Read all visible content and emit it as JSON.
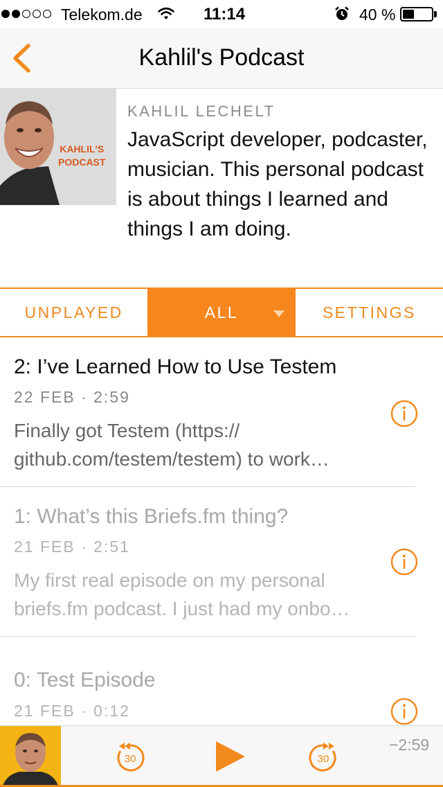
{
  "status_bar": {
    "signal_strength": 2,
    "signal_max": 5,
    "carrier": "Telekom.de",
    "time": "11:14",
    "battery_percent": "40 %",
    "battery_level": 0.4
  },
  "nav": {
    "title": "Kahlil's Podcast",
    "back_icon": "chevron-left-icon"
  },
  "podcast": {
    "cover_text_line1": "KAHLIL'S",
    "cover_text_line2": "PODCAST",
    "author": "KAHLIL LECHELT",
    "description": "JavaScript developer, podcaster, musician. This personal podcast is about things I learned and things I am doing."
  },
  "tabs": [
    {
      "label": "UNPLAYED",
      "active": false
    },
    {
      "label": "ALL",
      "active": true
    },
    {
      "label": "SETTINGS",
      "active": false
    }
  ],
  "episodes": [
    {
      "title": "2: I’ve Learned How to Use Testem",
      "meta": "22 FEB · 2:59",
      "desc_line1": "Finally got Testem (https://",
      "desc_line2": "github.com/testem/testem) to work…",
      "played": false
    },
    {
      "title": "1: What’s this Briefs.fm thing?",
      "meta": "21 FEB · 2:51",
      "desc_line1": "My first real episode on my personal",
      "desc_line2": "briefs.fm podcast. I just had my onbo…",
      "played": true
    },
    {
      "title": "0: Test Episode",
      "meta": "21 FEB · 0:12",
      "played": true
    }
  ],
  "player": {
    "skip_back_seconds": "30",
    "skip_forward_seconds": "30",
    "time_remaining": "−2:59",
    "progress": 0.0
  },
  "colors": {
    "accent": "#f7861d",
    "accent_text": "#ef8a1f",
    "nav_background": "#f7f7f7"
  }
}
